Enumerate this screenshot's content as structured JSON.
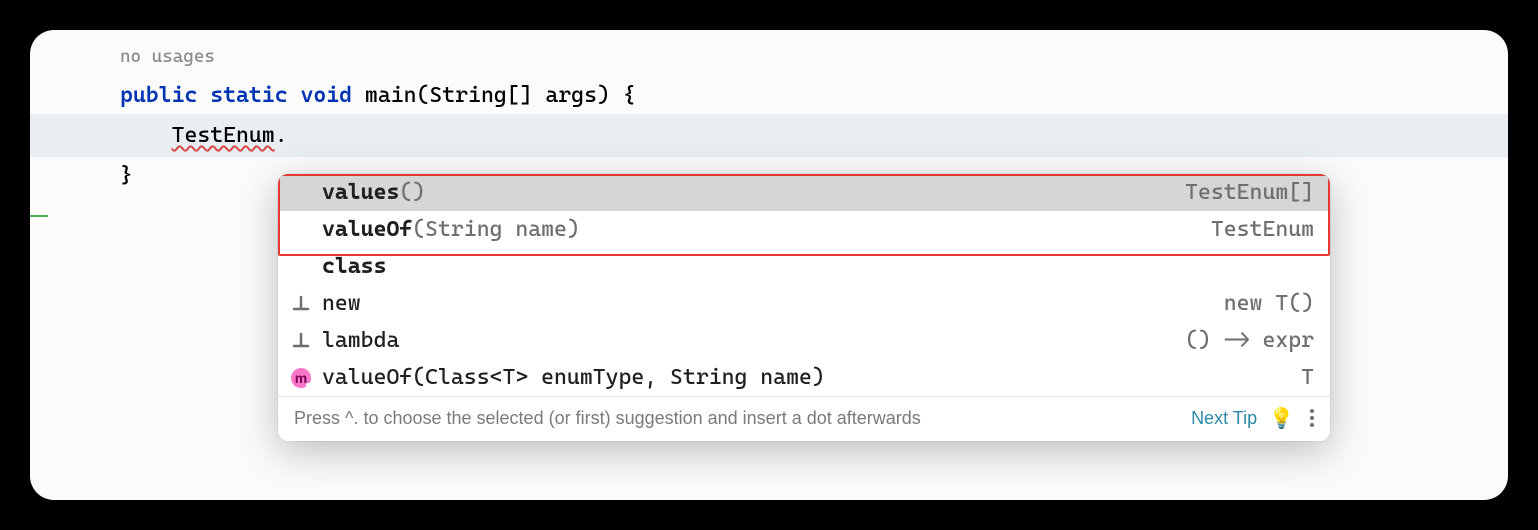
{
  "editor": {
    "usage_hint": "no usages",
    "lines": {
      "l1_public": "public",
      "l1_static": "static",
      "l1_void": "void",
      "l1_main": "main",
      "l1_argtype": "String",
      "l1_argname": "args",
      "l2_text": "TestEnum",
      "l3_brace": "}"
    }
  },
  "popup": {
    "items": [
      {
        "bold": "values",
        "params": "()",
        "ret": "TestEnum[]",
        "icon": "none",
        "selected": true
      },
      {
        "bold": "valueOf",
        "params": "(String name)",
        "ret": "TestEnum",
        "icon": "none",
        "selected": false
      },
      {
        "bold": "class",
        "params": "",
        "ret": "",
        "icon": "none",
        "selected": false
      },
      {
        "bold": "",
        "params": "new",
        "ret": "new T()",
        "icon": "template",
        "selected": false
      },
      {
        "bold": "",
        "params": "lambda",
        "ret": "() -> expr",
        "icon": "template",
        "selected": false
      },
      {
        "bold": "",
        "params": "valueOf(Class<T> enumType, String name)",
        "ret": "T",
        "icon": "method",
        "selected": false
      }
    ],
    "footer_text": "Press ^. to choose the selected (or first) suggestion and insert a dot afterwards",
    "next_tip": "Next Tip"
  }
}
